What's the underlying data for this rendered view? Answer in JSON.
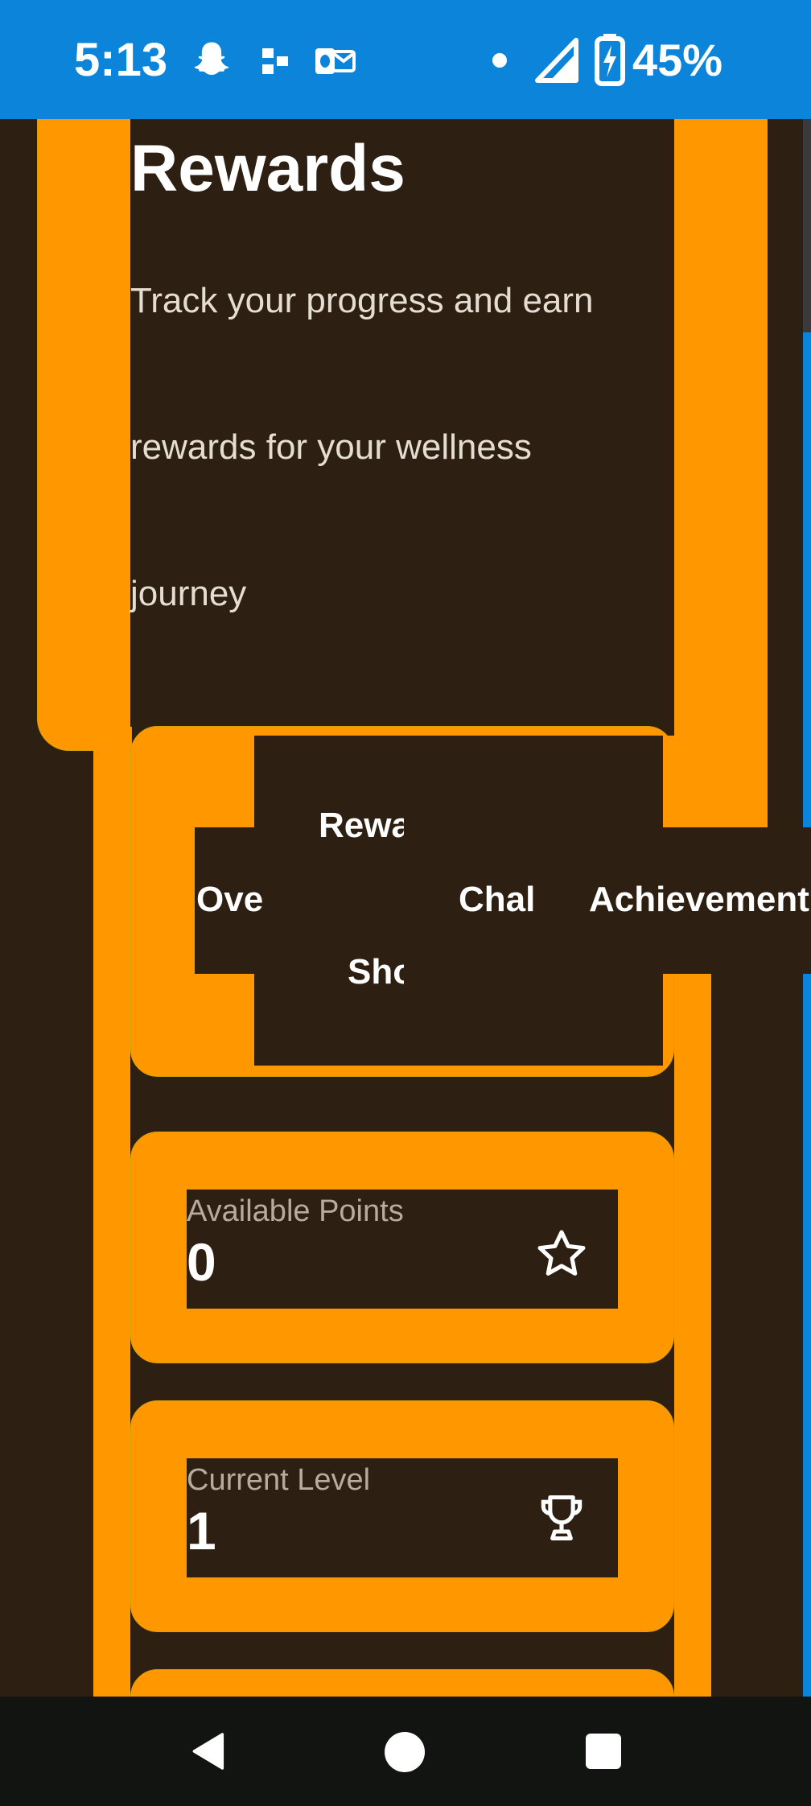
{
  "status_bar": {
    "time": "5:13",
    "icons": [
      "snapchat-icon",
      "app-icon",
      "outlook-icon",
      "notification-dot-icon",
      "cell-signal-icon",
      "battery-charging-icon"
    ],
    "battery_percent": "45%"
  },
  "page": {
    "title": "Rewards",
    "subtitle_lines": [
      "Track your progress and earn",
      "rewards for your wellness",
      "journey"
    ]
  },
  "tabs": [
    {
      "label": "Over"
    },
    {
      "label": "Rewa"
    },
    {
      "label": "Sho"
    },
    {
      "label": "Chal"
    },
    {
      "label": "Achievement"
    }
  ],
  "stats": [
    {
      "label": "Available Points",
      "value": "0",
      "icon": "star-icon"
    },
    {
      "label": "Current Level",
      "value": "1",
      "icon": "trophy-icon"
    }
  ],
  "colors": {
    "accent": "#ff9800",
    "background": "#2d1f12",
    "status_bar": "#0c84da",
    "nav_bar": "#121411"
  },
  "nav": {
    "buttons": [
      "back-icon",
      "home-icon",
      "recents-icon"
    ]
  }
}
